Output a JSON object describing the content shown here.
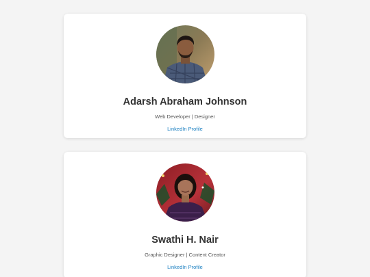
{
  "profiles": [
    {
      "name": "Adarsh Abraham Johnson",
      "role": "Web Developer | Designer",
      "link_label": "LinkedIn Profile"
    },
    {
      "name": "Swathi H. Nair",
      "role": "Graphic Designer | Content Creator",
      "link_label": "LinkedIn Profile"
    }
  ],
  "colors": {
    "background": "#f4f4f4",
    "card": "#ffffff",
    "name_text": "#333333",
    "link": "#1a7fc1"
  }
}
